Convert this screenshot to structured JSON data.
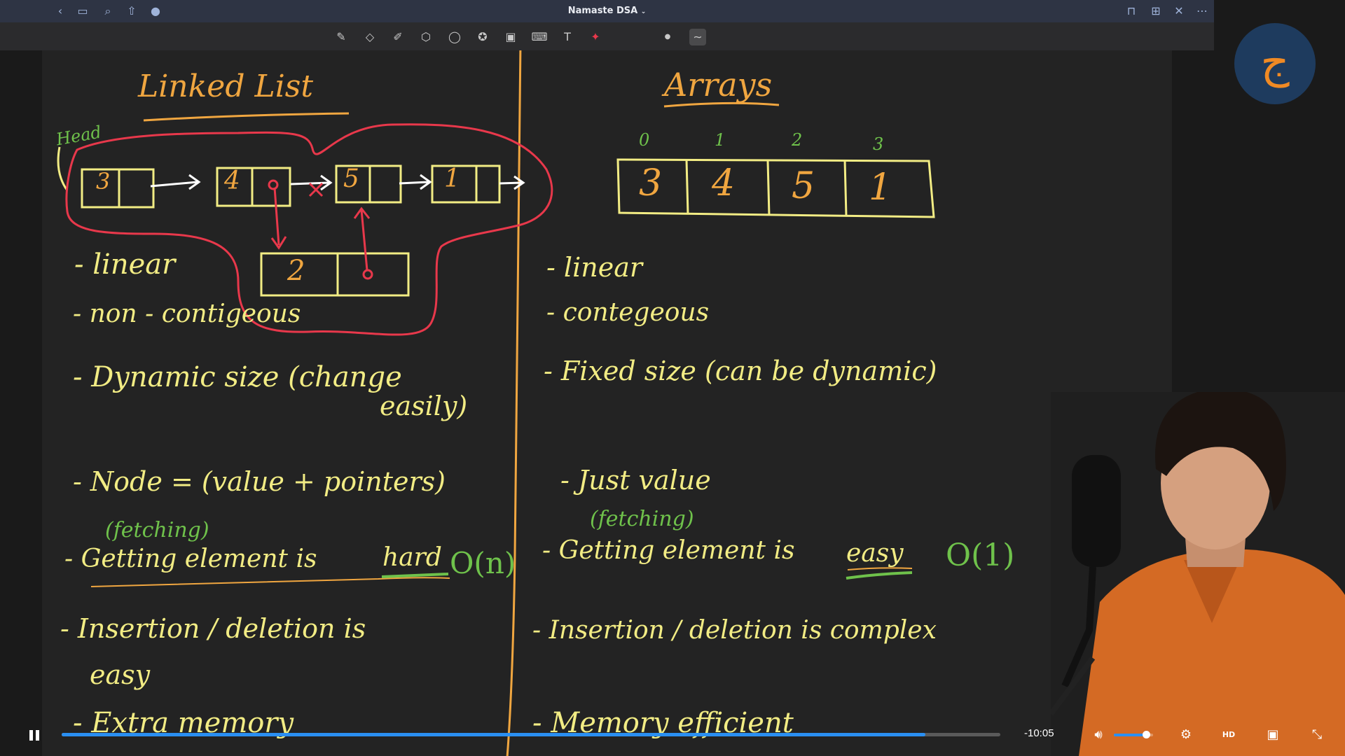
{
  "app": {
    "title": "Namaste DSA"
  },
  "colors": {
    "ink_yellow": "#f2ec84",
    "ink_orange": "#f0a640",
    "ink_green": "#6fc24b",
    "ink_red": "#e8384b",
    "accent": "#2a8ff2"
  },
  "appbar_icons": [
    "back-icon",
    "sidebar-icon",
    "search-icon",
    "share-icon",
    "microphone-icon",
    "bookmark-icon",
    "add-page-icon",
    "close-icon",
    "more-icon"
  ],
  "toolbar_icons": [
    "pen-icon",
    "eraser-icon",
    "highlighter-icon",
    "shapes-icon",
    "lasso-icon",
    "sticker-icon",
    "image-icon",
    "keyboard-icon",
    "text-box-icon",
    "laser-pointer-icon",
    "dot-icon",
    "stroke-icon"
  ],
  "notes": {
    "left": {
      "heading": "Linked List",
      "head_label": "Head",
      "nodes": [
        "3",
        "4",
        "5",
        "1"
      ],
      "inserted_node": "2",
      "points": {
        "p1": "- linear",
        "p2": "- non - contigeous",
        "p3a": "- Dynamic size (change",
        "p3b": "easily)",
        "p4": "- Node = (value + pointers)",
        "p5_note": "(fetching)",
        "p5": "- Getting element is",
        "p5_hard": "hard",
        "p5_complexity": "O(n)",
        "p6a": "- Insertion / deletion is",
        "p6b": "easy",
        "p7": "- Extra memory"
      }
    },
    "right": {
      "heading": "Arrays",
      "indices": [
        "0",
        "1",
        "2",
        "3"
      ],
      "cells": [
        "3",
        "4",
        "5",
        "1"
      ],
      "points": {
        "p1": "- linear",
        "p2": "- contegeous",
        "p3": "- Fixed size (can be dynamic)",
        "p4": "- Just value",
        "p5_note": "(fetching)",
        "p5": "- Getting element is",
        "p5_easy": "easy",
        "p5_complexity": "O(1)",
        "p6": "- Insertion / deletion is complex",
        "p7": "- Memory efficient"
      }
    }
  },
  "player": {
    "time_remaining": "-10:05",
    "progress_fraction": 0.92,
    "buffer_fraction": 0.555,
    "volume_fraction": 0.82,
    "icons": [
      "pause-icon",
      "volume-icon",
      "settings-icon",
      "hd-icon",
      "picture-in-picture-icon",
      "exit-fullscreen-icon"
    ]
  },
  "logo": {
    "glyph": "ج"
  }
}
